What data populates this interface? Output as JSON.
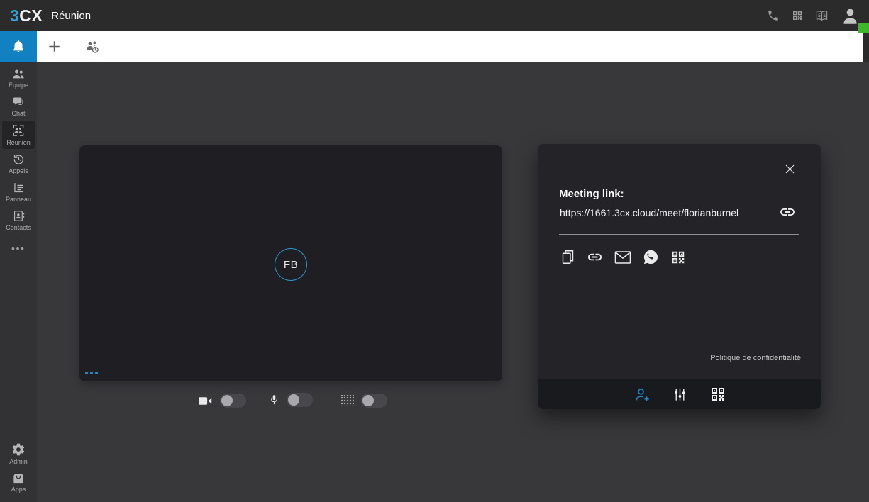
{
  "header": {
    "logo_blue": "3",
    "logo_white": "CX",
    "app_title": "Réunion",
    "right_icons": [
      "phone-icon",
      "dialpad-qr-icon",
      "contacts-book-icon",
      "avatar-icon"
    ],
    "status_color": "#3db629"
  },
  "tabbar": {
    "active_tab_icon": "bell-icon",
    "tab_icons": [
      "add-tab-icon",
      "scheduled-meeting-icon"
    ]
  },
  "sidebar": {
    "items": [
      {
        "id": "equipe",
        "label": "Équipe",
        "icon": "team-icon",
        "selected": false
      },
      {
        "id": "chat",
        "label": "Chat",
        "icon": "chat-icon",
        "selected": false
      },
      {
        "id": "reunion",
        "label": "Réunion",
        "icon": "meeting-icon",
        "selected": true
      },
      {
        "id": "appels",
        "label": "Appels",
        "icon": "call-history-icon",
        "selected": false
      },
      {
        "id": "panneau",
        "label": "Panneau",
        "icon": "wallboard-icon",
        "selected": false
      },
      {
        "id": "contacts",
        "label": "Contacts",
        "icon": "contacts-icon",
        "selected": false
      }
    ],
    "bottom_items": [
      {
        "id": "admin",
        "label": "Admin",
        "icon": "gear-icon"
      },
      {
        "id": "apps",
        "label": "Apps",
        "icon": "apps-box-icon"
      }
    ]
  },
  "video_preview": {
    "avatar_initials": "FB",
    "overflow_menu_icon": "ellipsis-icon"
  },
  "toggles": {
    "camera_on": false,
    "microphone_on": false,
    "blur_on": false
  },
  "share_panel": {
    "meeting_link_label": "Meeting link:",
    "meeting_url": "https://1661.3cx.cloud/meet/florianburnel",
    "copy_icon": "link-icon",
    "share_icons": [
      "copy-icon",
      "link-icon",
      "email-icon",
      "whatsapp-icon",
      "qr-code-icon"
    ],
    "privacy_link": "Politique de confidentialité",
    "footer_icons": [
      "add-person-icon",
      "settings-sliders-icon",
      "qr-code-icon"
    ],
    "footer_active_icon": "add-person-icon"
  },
  "colors": {
    "accent_blue": "#2191cc",
    "tab_active_blue": "#1181c2",
    "status_green": "#3db629",
    "topbar_bg": "#2b2b2b",
    "panel_bg": "#242428"
  }
}
